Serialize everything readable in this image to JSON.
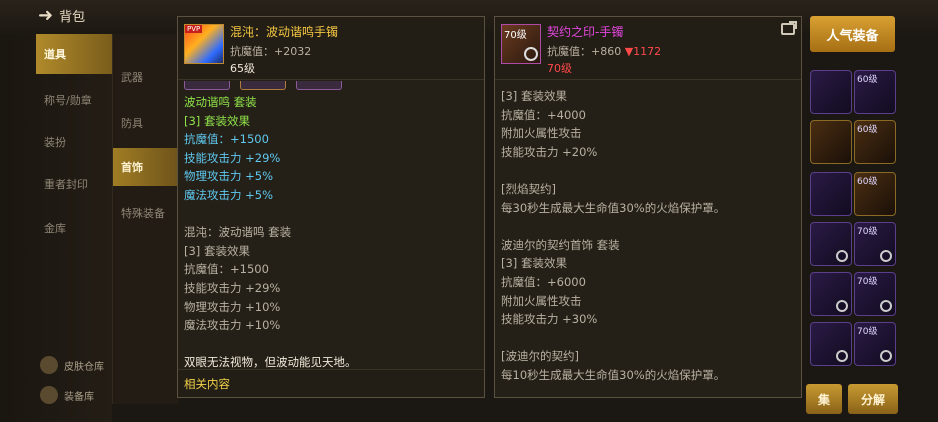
{
  "header": {
    "back_label": "背包"
  },
  "left_nav": {
    "items": [
      {
        "label": "道具"
      },
      {
        "label": "称号/勋章"
      },
      {
        "label": "装扮"
      },
      {
        "label": "重者封印"
      },
      {
        "label": "金库"
      }
    ],
    "bottom": [
      {
        "label": "皮肤仓库"
      },
      {
        "label": "装备库"
      }
    ]
  },
  "sub_nav": {
    "items": [
      {
        "label": "武器"
      },
      {
        "label": "防具"
      },
      {
        "label": "首饰"
      },
      {
        "label": "特殊装备"
      }
    ]
  },
  "right_grid": {
    "slots": [
      {
        "level": ""
      },
      {
        "level": "60级"
      },
      {
        "level": ""
      },
      {
        "level": "60级"
      },
      {
        "level": ""
      },
      {
        "level": "60级"
      },
      {
        "level": ""
      },
      {
        "level": "70级"
      },
      {
        "level": ""
      },
      {
        "level": "70级"
      },
      {
        "level": ""
      },
      {
        "level": "70级"
      }
    ]
  },
  "buttons": {
    "popular_equipment": "人气装备",
    "disassemble": "分解",
    "left_partial": "集"
  },
  "tooltip_left": {
    "name": "混沌：波动谐鸣手镯",
    "name_color": "#f5c842",
    "stat": "抗魔值：+2032",
    "level": "65级",
    "badge": "PVP",
    "lines": [
      {
        "text": "波动谐鸣 套装",
        "color": "green"
      },
      {
        "text": "[3] 套装效果",
        "color": "green"
      },
      {
        "text": "抗魔值：+1500",
        "color": "blue"
      },
      {
        "text": "技能攻击力 +29%",
        "color": "blue"
      },
      {
        "text": "物理攻击力 +5%",
        "color": "blue"
      },
      {
        "text": "魔法攻击力 +5%",
        "color": "blue"
      },
      {
        "text": "",
        "color": "gray"
      },
      {
        "text": "混沌：波动谐鸣 套装",
        "color": "gray"
      },
      {
        "text": "[3] 套装效果",
        "color": "gray"
      },
      {
        "text": "抗魔值：+1500",
        "color": "gray"
      },
      {
        "text": "技能攻击力 +29%",
        "color": "gray"
      },
      {
        "text": "物理攻击力 +10%",
        "color": "gray"
      },
      {
        "text": "魔法攻击力 +10%",
        "color": "gray"
      },
      {
        "text": "",
        "color": "gray"
      },
      {
        "text": "双眼无法视物，但波动能见天地。",
        "color": "white"
      }
    ],
    "related_label": "相关内容"
  },
  "tooltip_right": {
    "name": "契约之印-手镯",
    "name_color": "#e448e0",
    "stat": "抗魔值：+860",
    "stat_diff": "▼1172",
    "level": "70级",
    "icon_level": "70级",
    "lines": [
      {
        "text": "[3] 套装效果",
        "color": "gray"
      },
      {
        "text": "抗魔值：+4000",
        "color": "gray"
      },
      {
        "text": "附加火属性攻击",
        "color": "gray"
      },
      {
        "text": "技能攻击力 +20%",
        "color": "gray"
      },
      {
        "text": "",
        "color": "gray"
      },
      {
        "text": "[烈焰契约]",
        "color": "gray"
      },
      {
        "text": "每30秒生成最大生命值30%的火焰保护罩。",
        "color": "gray"
      },
      {
        "text": "",
        "color": "gray"
      },
      {
        "text": "波迪尔的契约首饰 套装",
        "color": "gray"
      },
      {
        "text": "[3] 套装效果",
        "color": "gray"
      },
      {
        "text": "抗魔值：+6000",
        "color": "gray"
      },
      {
        "text": "附加火属性攻击",
        "color": "gray"
      },
      {
        "text": "技能攻击力 +30%",
        "color": "gray"
      },
      {
        "text": "",
        "color": "gray"
      },
      {
        "text": "[波迪尔的契约]",
        "color": "gray"
      },
      {
        "text": "每10秒生成最大生命值30%的火焰保护罩。",
        "color": "gray"
      }
    ]
  }
}
